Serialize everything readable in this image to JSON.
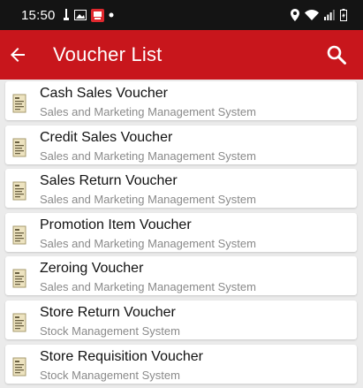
{
  "status_bar": {
    "time": "15:50",
    "left_icons": [
      "usb-icon",
      "image-icon",
      "app-notification-icon",
      "dot-icon"
    ],
    "right_icons": [
      "location-icon",
      "wifi-icon",
      "signal-icon",
      "battery-icon"
    ]
  },
  "app_bar": {
    "title": "Voucher List",
    "back_icon": "back-arrow-icon",
    "search_icon": "search-icon",
    "color": "#c8161c"
  },
  "vouchers": [
    {
      "title": "Cash Sales Voucher",
      "subtitle": "Sales and Marketing Management System"
    },
    {
      "title": "Credit Sales Voucher",
      "subtitle": "Sales and Marketing Management System"
    },
    {
      "title": "Sales Return Voucher",
      "subtitle": "Sales and Marketing Management System"
    },
    {
      "title": "Promotion Item Voucher",
      "subtitle": "Sales and Marketing Management System"
    },
    {
      "title": "Zeroing Voucher",
      "subtitle": "Sales and Marketing Management System"
    },
    {
      "title": "Store Return Voucher",
      "subtitle": "Stock Management System"
    },
    {
      "title": "Store Requisition Voucher",
      "subtitle": "Stock Management System"
    }
  ]
}
